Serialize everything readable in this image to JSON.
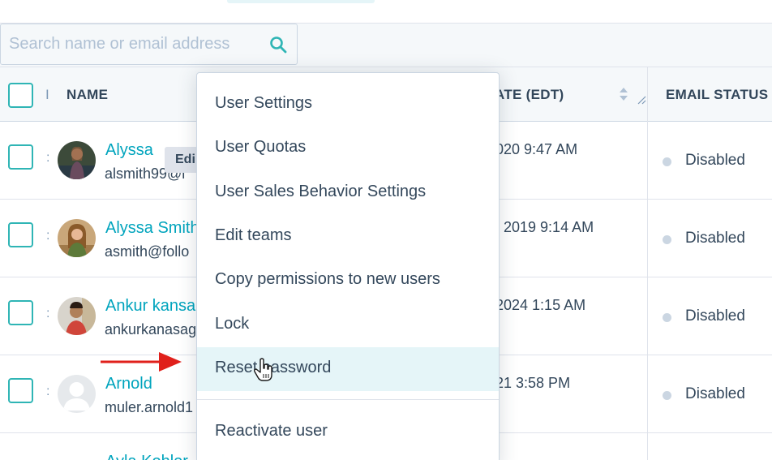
{
  "search": {
    "placeholder": "Search name or email address"
  },
  "columns": {
    "select_marker": "I",
    "name": "NAME",
    "date": "ATE (EDT)",
    "email_status": "EMAIL STATUS"
  },
  "rows": [
    {
      "name": "Alyssa",
      "email": "alsmith99@i",
      "date": "020 9:47 AM",
      "status": "Disabled",
      "hover_chip": "Edi"
    },
    {
      "name": "Alyssa Smith",
      "email": "asmith@follo",
      "date": ", 2019 9:14 AM",
      "status": "Disabled"
    },
    {
      "name": "Ankur kansa",
      "email": "ankurkanasag",
      "date": "2024 1:15 AM",
      "status": "Disabled"
    },
    {
      "name": "Arnold",
      "email": "muler.arnold1",
      "date": "21 3:58 PM",
      "status": "Disabled"
    },
    {
      "name": "Ayla Kohler"
    }
  ],
  "menu": {
    "items": [
      "User Settings",
      "User Quotas",
      "User Sales Behavior Settings",
      "Edit teams",
      "Copy permissions to new users",
      "Lock",
      "Reset password",
      "Reactivate user"
    ],
    "highlighted": "Reset password"
  },
  "colors": {
    "accent": "#00a4bd",
    "checkbox": "#2fb5b5",
    "annotation_arrow": "#e0201b",
    "menu_highlight": "#e5f5f8"
  }
}
